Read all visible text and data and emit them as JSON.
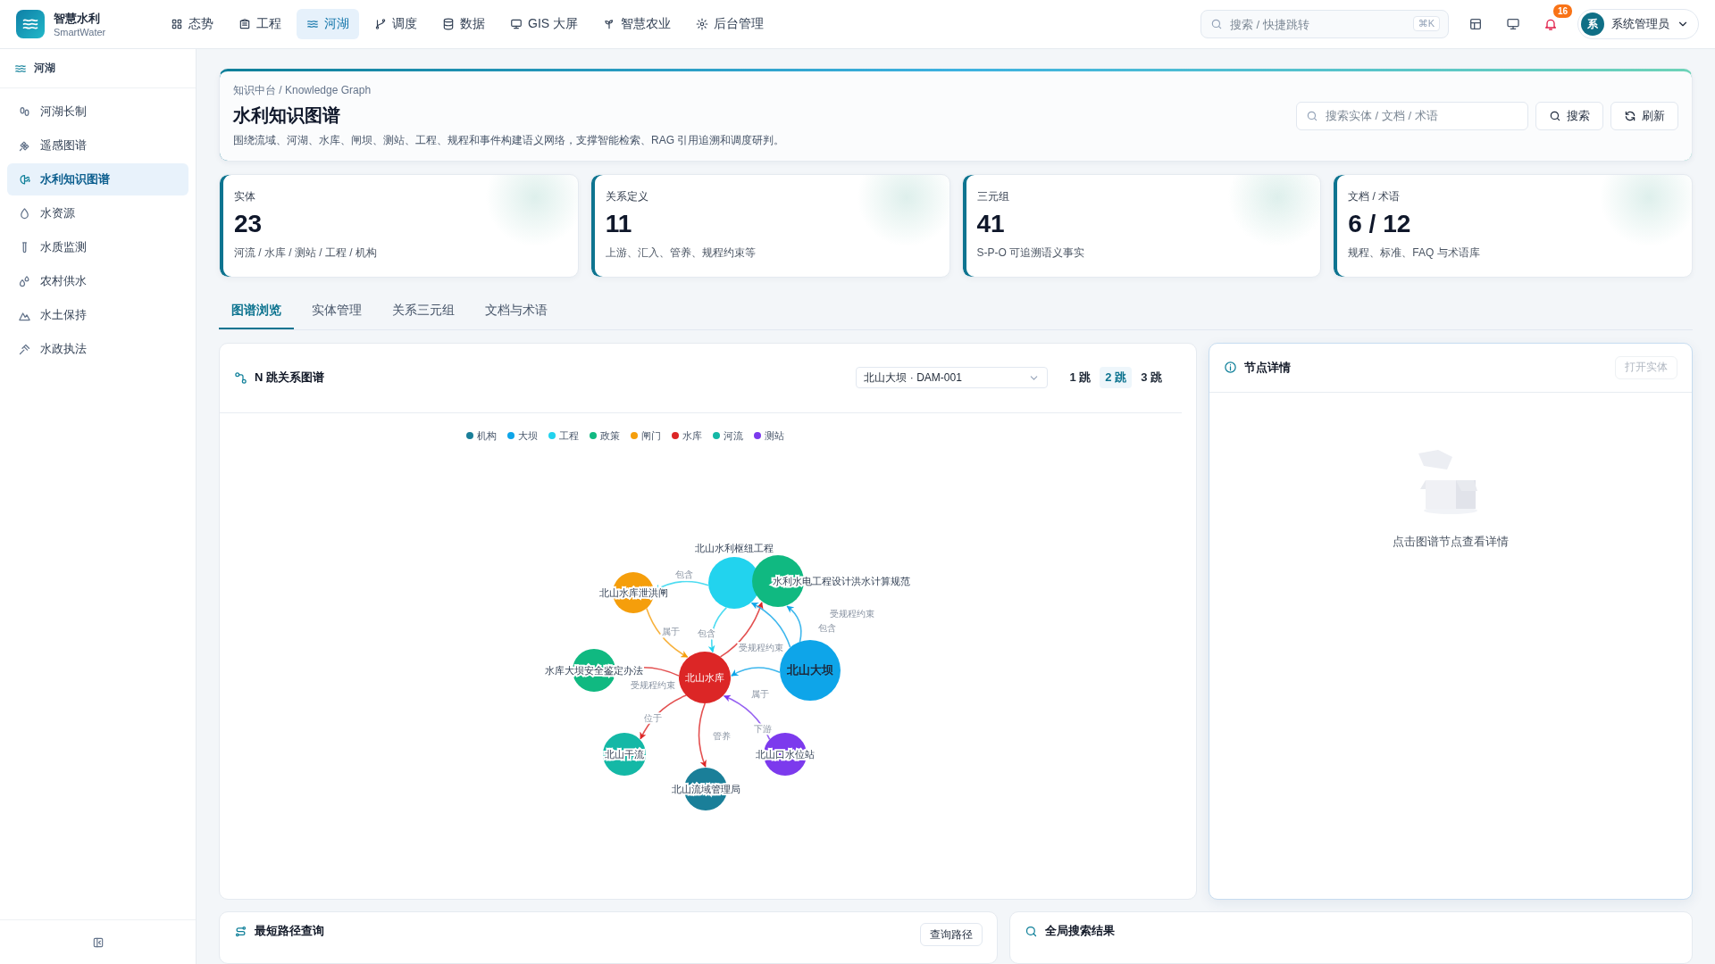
{
  "app": {
    "name": "智慧水利",
    "subtitle": "SmartWater"
  },
  "nav": [
    {
      "label": "态势",
      "selected": false
    },
    {
      "label": "工程",
      "selected": false
    },
    {
      "label": "河湖",
      "selected": true
    },
    {
      "label": "调度",
      "selected": false
    },
    {
      "label": "数据",
      "selected": false
    },
    {
      "label": "GIS 大屏",
      "selected": false
    },
    {
      "label": "智慧农业",
      "selected": false
    },
    {
      "label": "后台管理",
      "selected": false
    }
  ],
  "search": {
    "placeholder": "搜索 / 快捷跳转",
    "shortcut": "⌘K"
  },
  "notifications": {
    "count": "16"
  },
  "user": {
    "avatar": "系",
    "name": "系统管理员"
  },
  "sidebar": {
    "section": "河湖",
    "items": [
      {
        "label": "河湖长制",
        "selected": false
      },
      {
        "label": "遥感图谱",
        "selected": false
      },
      {
        "label": "水利知识图谱",
        "selected": true
      },
      {
        "label": "水资源",
        "selected": false
      },
      {
        "label": "水质监测",
        "selected": false
      },
      {
        "label": "农村供水",
        "selected": false
      },
      {
        "label": "水土保持",
        "selected": false
      },
      {
        "label": "水政执法",
        "selected": false
      }
    ]
  },
  "header": {
    "breadcrumb": "知识中台 / Knowledge Graph",
    "title": "水利知识图谱",
    "description": "围绕流域、河湖、水库、闸坝、测站、工程、规程和事件构建语义网络，支撑智能检索、RAG 引用追溯和调度研判。",
    "search": {
      "placeholder": "搜索实体 / 文档 / 术语"
    },
    "buttons": [
      "搜索",
      "刷新"
    ]
  },
  "stats": [
    {
      "label": "实体",
      "value": "23",
      "note": "河流 / 水库 / 测站 / 工程 / 机构"
    },
    {
      "label": "关系定义",
      "value": "11",
      "note": "上游、汇入、管养、规程约束等"
    },
    {
      "label": "三元组",
      "value": "41",
      "note": "S-P-O 可追溯语义事实"
    },
    {
      "label": "文档 / 术语",
      "value": "6 / 12",
      "note": "规程、标准、FAQ 与术语库"
    }
  ],
  "tabs": [
    {
      "label": "图谱浏览",
      "selected": true
    },
    {
      "label": "实体管理",
      "selected": false
    },
    {
      "label": "关系三元组",
      "selected": false
    },
    {
      "label": "文档与术语",
      "selected": false
    }
  ],
  "graph_panel": {
    "title": "N 跳关系图谱",
    "entity_select": "北山大坝 · DAM-001",
    "hops": [
      {
        "label": "1 跳",
        "selected": false
      },
      {
        "label": "2 跳",
        "selected": true
      },
      {
        "label": "3 跳",
        "selected": false
      }
    ],
    "legend": [
      {
        "label": "机构",
        "color": "#1a7f99"
      },
      {
        "label": "大坝",
        "color": "#0ea5e9"
      },
      {
        "label": "工程",
        "color": "#22d3ee"
      },
      {
        "label": "政策",
        "color": "#10b981"
      },
      {
        "label": "闸门",
        "color": "#f59e0b"
      },
      {
        "label": "水库",
        "color": "#dc2626"
      },
      {
        "label": "河流",
        "color": "#14b8a6"
      },
      {
        "label": "测站",
        "color": "#7c3aed"
      }
    ],
    "nodes": [
      {
        "label": "北山水库",
        "color": "#dc2626"
      },
      {
        "label": "北山水库泄洪闸",
        "color": "#f59e0b"
      },
      {
        "label": "北山水利枢纽工程",
        "color": "#22d3ee"
      },
      {
        "label": "水利水电工程设计洪水计算规范",
        "color": "#10b981"
      },
      {
        "label": "北山大坝",
        "color": "#0ea5e9"
      },
      {
        "label": "水库大坝安全鉴定办法",
        "color": "#10b981"
      },
      {
        "label": "北山干流",
        "color": "#14b8a6"
      },
      {
        "label": "北山流域管理局",
        "color": "#1a7f99"
      },
      {
        "label": "北山口水位站",
        "color": "#7c3aed"
      }
    ],
    "edges": [
      {
        "label": "包含"
      },
      {
        "label": "属于"
      },
      {
        "label": "包含"
      },
      {
        "label": "受规程约束"
      },
      {
        "label": "包含"
      },
      {
        "label": "受规程约束"
      },
      {
        "label": "属于"
      },
      {
        "label": "受规程约束"
      },
      {
        "label": "位于"
      },
      {
        "label": "管养"
      },
      {
        "label": "下游"
      }
    ]
  },
  "detail_panel": {
    "title": "节点详情",
    "button": {
      "label": "打开实体",
      "disabled": true
    },
    "empty_text": "点击图谱节点查看详情"
  },
  "path_panel": {
    "title": "最短路径查询",
    "button": "查询路径"
  },
  "search_results": {
    "title": "全局搜索结果"
  }
}
